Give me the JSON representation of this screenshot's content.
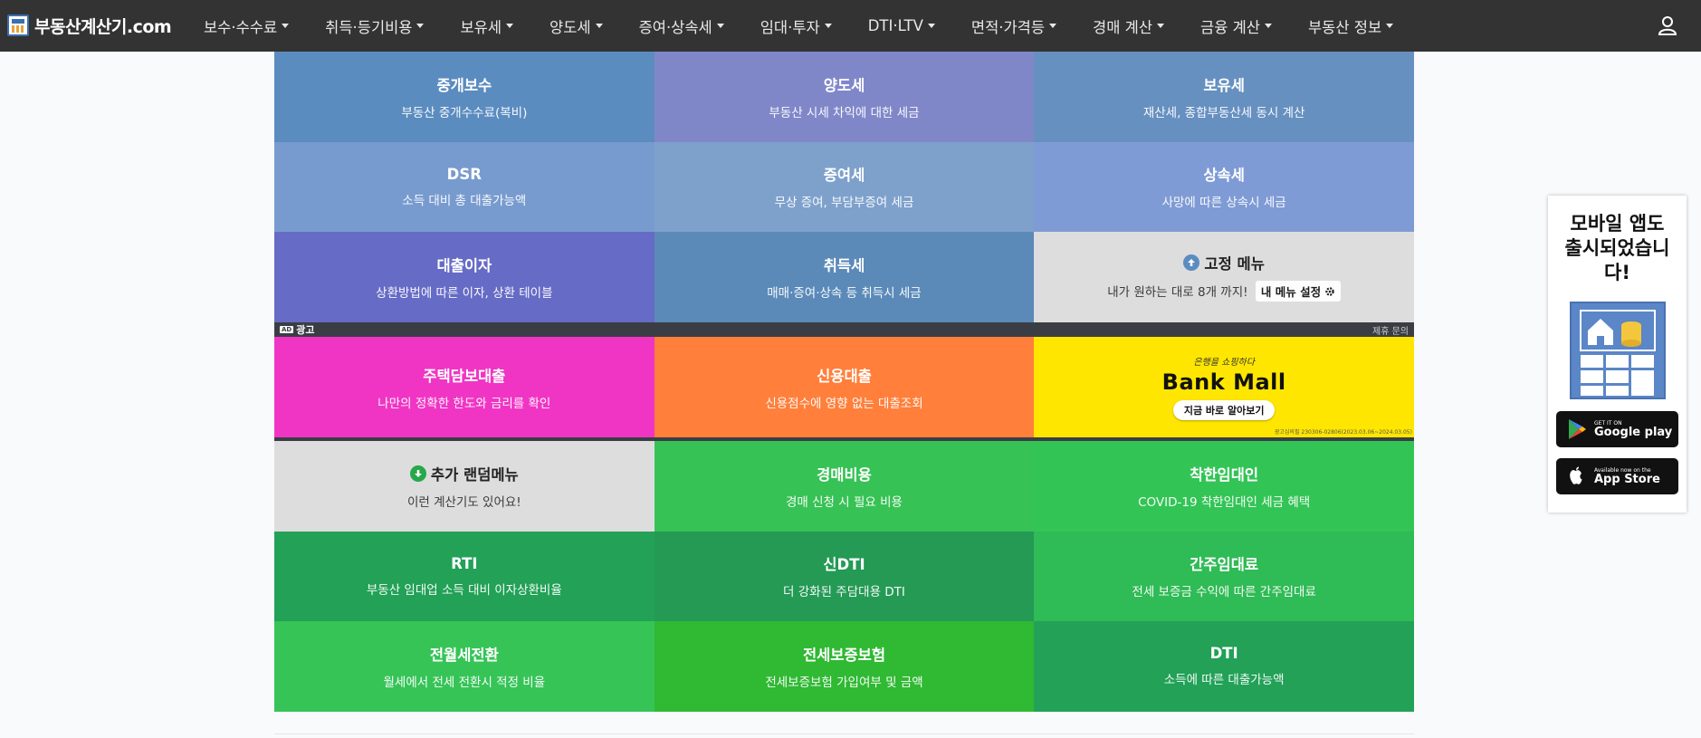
{
  "brand": {
    "name": "부동산계산기.com"
  },
  "nav": [
    {
      "label": "보수·수수료"
    },
    {
      "label": "취득·등기비용"
    },
    {
      "label": "보유세"
    },
    {
      "label": "양도세"
    },
    {
      "label": "증여·상속세"
    },
    {
      "label": "임대·투자"
    },
    {
      "label": "DTI·LTV"
    },
    {
      "label": "면적·가격등"
    },
    {
      "label": "경매 계산"
    },
    {
      "label": "금융 계산"
    },
    {
      "label": "부동산 정보"
    }
  ],
  "tiles_top": [
    [
      {
        "title": "중개보수",
        "sub": "부동산 중개수수료(복비)",
        "color": "#5b8cc0"
      },
      {
        "title": "양도세",
        "sub": "부동산 시세 차익에 대한 세금",
        "color": "#8087c9"
      },
      {
        "title": "보유세",
        "sub": "재산세, 종합부동산세 동시 계산",
        "color": "#6690c0"
      }
    ],
    [
      {
        "title": "DSR",
        "sub": "소득 대비 총 대출가능액",
        "color": "#789bcf"
      },
      {
        "title": "증여세",
        "sub": "무상 증여, 부담부증여 세금",
        "color": "#7ea1cc"
      },
      {
        "title": "상속세",
        "sub": "사망에 따른 상속시 세금",
        "color": "#7f9bd5"
      }
    ],
    [
      {
        "title": "대출이자",
        "sub": "상환방법에 따른 이자, 상환 테이블",
        "color": "#666bc6"
      },
      {
        "title": "취득세",
        "sub": "매매·증여·상속 등 취득시 세금",
        "color": "#5b8ab9"
      }
    ]
  ],
  "fixed_menu": {
    "title": "고정 메뉴",
    "sub": "내가 원하는 대로 8개 까지!",
    "button": "내 메뉴 설정",
    "color": "#dddddd"
  },
  "ad": {
    "label": "광고",
    "badge": "AD",
    "inquiry": "제휴 문의",
    "tiles": [
      {
        "title": "주택담보대출",
        "sub": "나만의 정확한 한도와 금리를 확인",
        "color": "#f035c4"
      },
      {
        "title": "신용대출",
        "sub": "신용점수에 영향 없는 대출조회",
        "color": "#ff7f3b"
      }
    ],
    "bank": {
      "tagline": "은행을 쇼핑하다",
      "title": "Bank Mall",
      "button": "지금 바로 알아보기",
      "fine": "광고심의필 230306-02806(2023.03.06~2024.03.05)",
      "color": "#ffe600"
    }
  },
  "random_menu": {
    "title": "추가 랜덤메뉴",
    "sub": "이런 계산기도 있어요!",
    "color": "#dddddd"
  },
  "tiles_bottom": [
    [
      {
        "title": "경매비용",
        "sub": "경매 신청 시 필요 비용",
        "color": "#37c255"
      },
      {
        "title": "착한임대인",
        "sub": "COVID-19 착한임대인 세금 혜택",
        "color": "#33c456"
      }
    ],
    [
      {
        "title": "RTI",
        "sub": "부동산 임대업 소득 대비 이자상환비율",
        "color": "#22a157"
      },
      {
        "title": "신DTI",
        "sub": "더 강화된 주담대용 DTI",
        "color": "#249a55"
      },
      {
        "title": "간주임대료",
        "sub": "전세 보증금 수익에 따른 간주임대료",
        "color": "#2fbb55"
      }
    ],
    [
      {
        "title": "전월세전환",
        "sub": "월세에서 전세 전환시 적정 비율",
        "color": "#36c457"
      },
      {
        "title": "전세보증보험",
        "sub": "전세보증보험 가입여부 및 금액",
        "color": "#30b933"
      },
      {
        "title": "DTI",
        "sub": "소득에 따른 대출가능액",
        "color": "#22a157"
      }
    ]
  ],
  "app_card": {
    "title": "모바일 앱도 출시되었습니다!",
    "google": {
      "small": "GET IT ON",
      "big": "Google play"
    },
    "apple": {
      "small": "Available now on the",
      "big": "App Store"
    }
  }
}
